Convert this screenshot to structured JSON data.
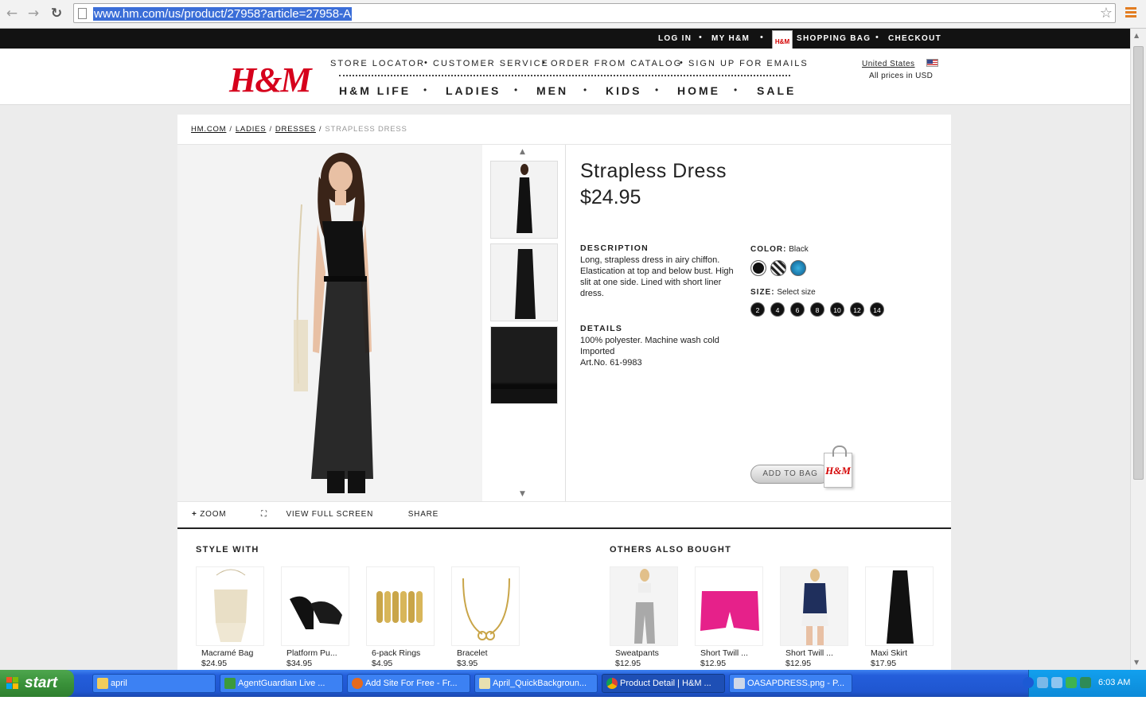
{
  "browser": {
    "url": "www.hm.com/us/product/27958?article=27958-A",
    "back_glyph": "←",
    "forward_glyph": "→",
    "reload_glyph": "↻",
    "star_glyph": "☆"
  },
  "topbar": {
    "login": "LOG IN",
    "my_hm": "MY H&M",
    "bag_logo": "H&M",
    "shopping_bag": "SHOPPING BAG",
    "checkout": "CHECKOUT",
    "dot": "•"
  },
  "header": {
    "logo": "H&M",
    "utility_links": [
      "STORE LOCATOR",
      "CUSTOMER SERVICE",
      "ORDER FROM CATALOG",
      "SIGN UP FOR EMAILS"
    ],
    "main_nav": [
      "H&M LIFE",
      "LADIES",
      "MEN",
      "KIDS",
      "HOME",
      "SALE"
    ],
    "country": "United States",
    "prices_note": "All prices in USD"
  },
  "breadcrumb": {
    "items": [
      "HM.COM",
      "LADIES",
      "DRESSES"
    ],
    "current": "STRAPLESS DRESS",
    "sep": "/"
  },
  "product": {
    "title": "Strapless Dress",
    "price": "$24.95",
    "description_heading": "DESCRIPTION",
    "description": "Long, strapless dress in airy chiffon. Elastication at top and below bust. High slit at one side. Lined with short liner dress.",
    "details_heading": "DETAILS",
    "details": [
      "100% polyester. Machine wash cold",
      "Imported",
      "Art.No. 61-9983"
    ],
    "color_label": "COLOR:",
    "color_value": "Black",
    "size_label": "SIZE:",
    "size_value": "Select size",
    "sizes": [
      "2",
      "4",
      "6",
      "8",
      "10",
      "12",
      "14"
    ],
    "add_to_bag": "ADD TO BAG",
    "bag_logo": "H&M"
  },
  "tools": {
    "zoom": "ZOOM",
    "full_screen": "VIEW FULL SCREEN",
    "share": "SHARE"
  },
  "style_with": {
    "heading": "STYLE WITH",
    "items": [
      {
        "name": "Macramé Bag",
        "price": "$24.95"
      },
      {
        "name": "Platform Pu...",
        "price": "$34.95"
      },
      {
        "name": "6-pack Rings",
        "price": "$4.95"
      },
      {
        "name": "Bracelet",
        "price": "$3.95"
      }
    ]
  },
  "others_bought": {
    "heading": "OTHERS ALSO BOUGHT",
    "items": [
      {
        "name": "Sweatpants",
        "price": "$12.95"
      },
      {
        "name": "Short Twill ...",
        "price": "$12.95"
      },
      {
        "name": "Short Twill ...",
        "price": "$12.95"
      },
      {
        "name": "Maxi Skirt",
        "price": "$17.95"
      }
    ]
  },
  "taskbar": {
    "start": "start",
    "tasks": [
      "april",
      "AgentGuardian Live ...",
      "Add Site For Free - Fr...",
      "April_QuickBackgroun...",
      "Product Detail | H&M ...",
      "OASAPDRESS.png - P..."
    ],
    "clock": "6:03 AM"
  },
  "colors": {
    "brand_red": "#d6001c",
    "topbar_bg": "#121212",
    "taskbar_blue": "#245edb",
    "start_green": "#3a923a"
  }
}
